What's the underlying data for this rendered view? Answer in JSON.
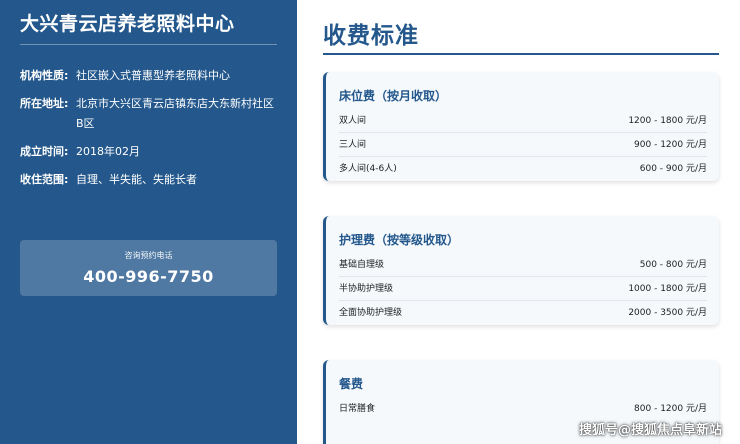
{
  "sidebar": {
    "org_name": "大兴青云店养老照料中心",
    "info": [
      {
        "label": "机构性质:",
        "value": "社区嵌入式普惠型养老照料中心"
      },
      {
        "label": "所在地址:",
        "value": "北京市大兴区青云店镇东店大东新村社区B区"
      },
      {
        "label": "成立时间:",
        "value": "2018年02月"
      },
      {
        "label": "收住范围:",
        "value": "自理、半失能、失能长者"
      }
    ],
    "phone_caption": "咨询预约电话",
    "phone_number": "400-996-7750"
  },
  "main": {
    "title": "收费标准",
    "cards": [
      {
        "title": "床位费（按月收取）",
        "rows": [
          {
            "label": "双人间",
            "price": "1200 - 1800 元/月"
          },
          {
            "label": "三人间",
            "price": "900 - 1200 元/月"
          },
          {
            "label": "多人间(4-6人)",
            "price": "600 - 900 元/月"
          }
        ]
      },
      {
        "title": "护理费（按等级收取）",
        "rows": [
          {
            "label": "基础自理级",
            "price": "500 - 800 元/月"
          },
          {
            "label": "半协助护理级",
            "price": "1000 - 1800 元/月"
          },
          {
            "label": "全面协助护理级",
            "price": "2000 - 3500 元/月"
          }
        ]
      },
      {
        "title": "餐费",
        "rows": [
          {
            "label": "日常膳食",
            "price": "800 - 1200 元/月"
          }
        ]
      }
    ]
  },
  "watermark": "搜狐号@搜狐焦点阜新站",
  "colors": {
    "primary": "#24588c",
    "card_bg": "#f5f9fc"
  }
}
